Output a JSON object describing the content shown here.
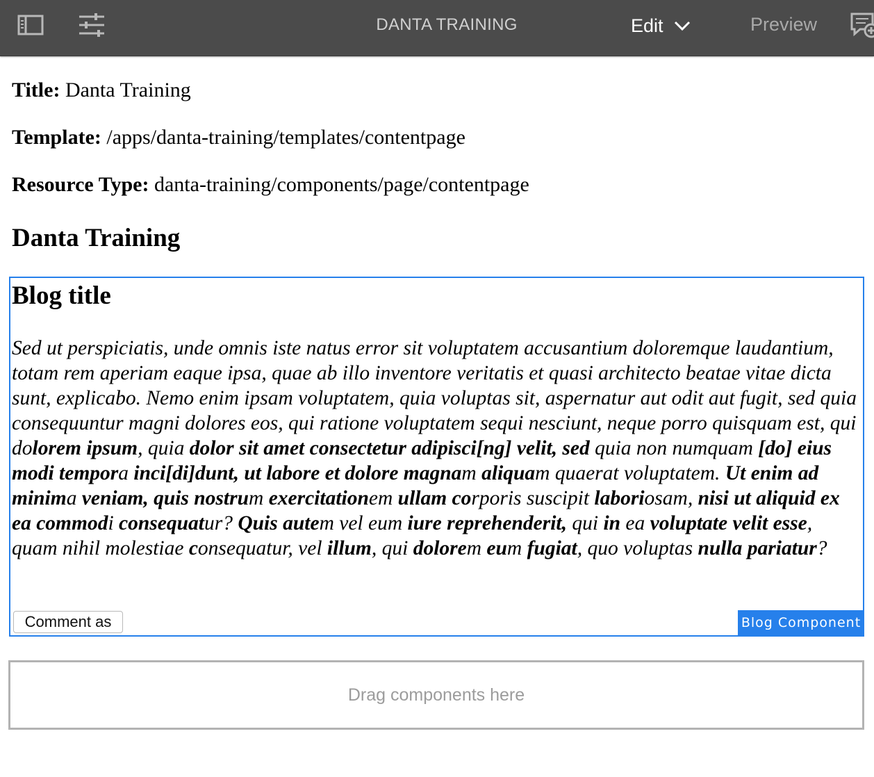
{
  "toolbar": {
    "title": "DANTA TRAINING",
    "edit_label": "Edit",
    "preview_label": "Preview",
    "icons": {
      "left1": "side-panel-icon",
      "left2": "page-properties-icon",
      "mode_dropdown": "chevron-down-icon",
      "right": "annotations-icon"
    },
    "colors": {
      "background": "#4b4b4b",
      "title": "#d0d0d0",
      "active": "#ffffff",
      "inactive": "#a9a9a9"
    }
  },
  "page_info": {
    "title_label": "Title:",
    "title_value": "Danta Training",
    "template_label": "Template:",
    "template_value": "/apps/danta-training/templates/contentpage",
    "resource_type_label": "Resource Type:",
    "resource_type_value": "danta-training/components/page/contentpage"
  },
  "page_heading": "Danta Training",
  "blog_component": {
    "title": "Blog title",
    "body_segments": [
      {
        "t": "Sed ut perspiciatis, unde omnis iste natus error sit voluptatem accusantium doloremque laudantium, totam rem aperiam eaque ipsa, quae ab illo inventore veritatis et quasi architecto beatae vitae dicta sunt, explicabo. Nemo enim ipsam voluptatem, quia voluptas sit, aspernatur aut odit aut fugit, sed quia consequuntur magni dolores eos, qui ratione voluptatem sequi nesciunt, neque porro quisquam est, qui do",
        "b": false
      },
      {
        "t": "lorem ipsum",
        "b": true
      },
      {
        "t": ", quia ",
        "b": false
      },
      {
        "t": "dolor sit amet consectetur adipisci[ng] velit, sed",
        "b": true
      },
      {
        "t": " quia non numquam ",
        "b": false
      },
      {
        "t": "[do] eius modi",
        "b": true
      },
      {
        "t": " ",
        "b": false
      },
      {
        "t": "tempor",
        "b": true
      },
      {
        "t": "a ",
        "b": false
      },
      {
        "t": "inci[di]dunt, ut labore et dolore magna",
        "b": true
      },
      {
        "t": "m ",
        "b": false
      },
      {
        "t": "aliqua",
        "b": true
      },
      {
        "t": "m quaerat voluptatem. ",
        "b": false
      },
      {
        "t": "Ut enim ad minim",
        "b": true
      },
      {
        "t": "a ",
        "b": false
      },
      {
        "t": "veniam, quis nostru",
        "b": true
      },
      {
        "t": "m ",
        "b": false
      },
      {
        "t": "exercitation",
        "b": true
      },
      {
        "t": "em ",
        "b": false
      },
      {
        "t": "ullam co",
        "b": true
      },
      {
        "t": "rporis suscipit ",
        "b": false
      },
      {
        "t": "labori",
        "b": true
      },
      {
        "t": "osam, ",
        "b": false
      },
      {
        "t": "nisi ut aliquid ex ea commod",
        "b": true
      },
      {
        "t": "i ",
        "b": false
      },
      {
        "t": "consequat",
        "b": true
      },
      {
        "t": "ur? ",
        "b": false
      },
      {
        "t": "Quis aute",
        "b": true
      },
      {
        "t": "m vel eum ",
        "b": false
      },
      {
        "t": "iure reprehenderit,",
        "b": true
      },
      {
        "t": " qui ",
        "b": false
      },
      {
        "t": "in",
        "b": true
      },
      {
        "t": " ea ",
        "b": false
      },
      {
        "t": "voluptate velit esse",
        "b": true
      },
      {
        "t": ", quam nihil molestiae ",
        "b": false
      },
      {
        "t": "c",
        "b": true
      },
      {
        "t": "onsequatur, vel ",
        "b": false
      },
      {
        "t": "illum",
        "b": true
      },
      {
        "t": ", qui ",
        "b": false
      },
      {
        "t": "dolore",
        "b": true
      },
      {
        "t": "m ",
        "b": false
      },
      {
        "t": "eu",
        "b": true
      },
      {
        "t": "m ",
        "b": false
      },
      {
        "t": "fugiat",
        "b": true
      },
      {
        "t": ", quo voluptas ",
        "b": false
      },
      {
        "t": "nulla pariatur",
        "b": true
      },
      {
        "t": "?",
        "b": false
      }
    ],
    "comment_button_label": "Comment as",
    "badge_label": "Blog Component",
    "accent_color": "#2680eb"
  },
  "dropzone": {
    "placeholder": "Drag components here"
  }
}
